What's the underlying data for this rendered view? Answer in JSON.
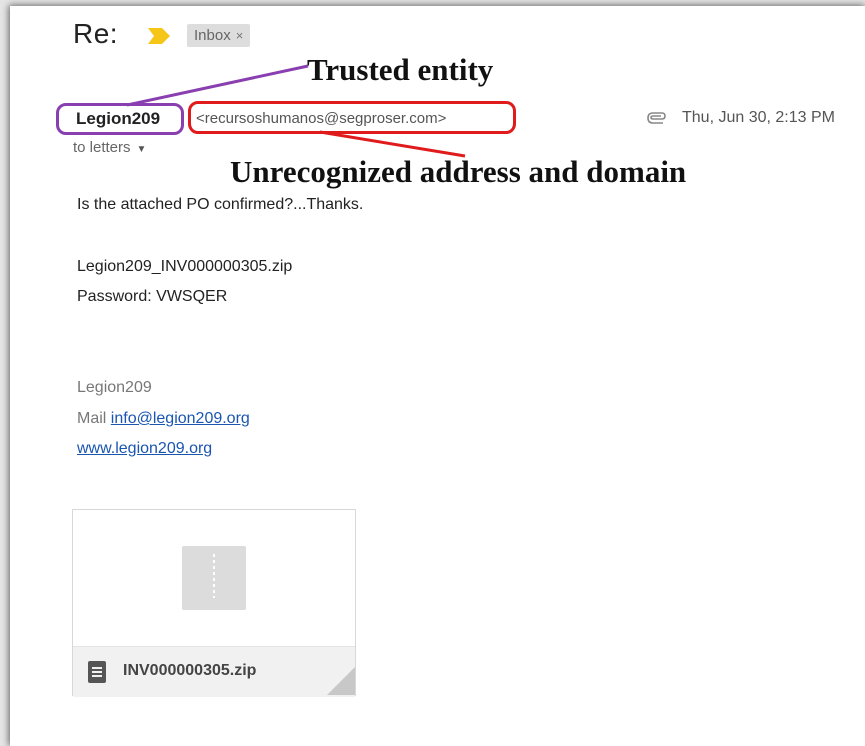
{
  "email": {
    "subject": "Re:",
    "label_chip": "Inbox",
    "label_chip_close": "×",
    "sender_name": "Legion209",
    "sender_email": "<recursoshumanos@segproser.com>",
    "date": "Thu, Jun 30, 2:13 PM",
    "recipients": "to letters",
    "body_line1": "Is the attached PO confirmed?...Thanks.",
    "attachment_line": "Legion209_INV000000305.zip",
    "password_line": "Password: VWSQER",
    "signature": {
      "name": "Legion209",
      "mail_prefix": "Mail",
      "mail_link": "info@legion209.org",
      "website": "www.legion209.org"
    },
    "attachment_card": {
      "filename": "INV000000305.zip"
    }
  },
  "annotations": {
    "trusted_entity": "Trusted entity",
    "unrecognized": "Unrecognized address and domain"
  },
  "colors": {
    "purple_callout": "#8a3fb0",
    "red_callout": "#e01b1b",
    "important_marker": "#f5c518",
    "link": "#1a55b0"
  },
  "icons": {
    "important": "important-marker-icon",
    "attachment": "paperclip-icon",
    "chip_close": "close-icon",
    "recipients_dropdown": "caret-down-icon",
    "file_type": "archive-file-icon"
  }
}
